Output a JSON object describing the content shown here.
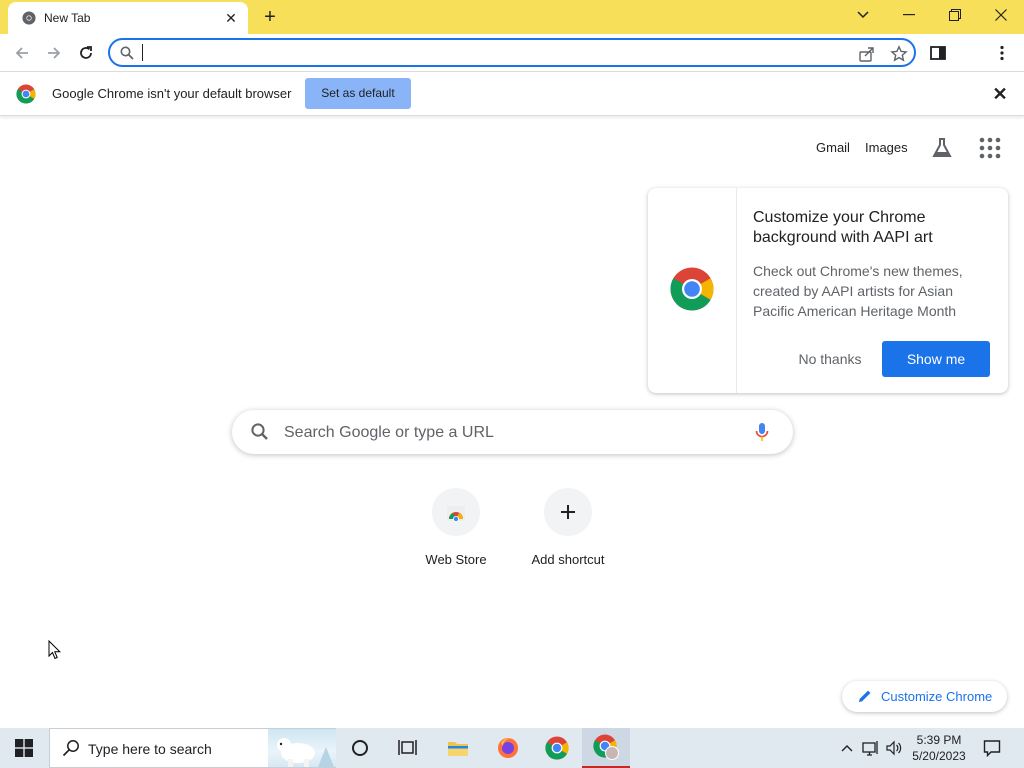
{
  "browser": {
    "tab_title": "New Tab",
    "omnibox_value": ""
  },
  "infobar": {
    "message": "Google Chrome isn't your default browser",
    "set_default_label": "Set as default"
  },
  "ntp": {
    "gmail_label": "Gmail",
    "images_label": "Images",
    "search_placeholder": "Search Google or type a URL",
    "shortcuts": [
      {
        "label": "Web Store"
      },
      {
        "label": "Add shortcut"
      }
    ],
    "customize_label": "Customize Chrome"
  },
  "promo": {
    "title": "Customize your Chrome background with AAPI art",
    "body": "Check out Chrome's new themes, created by AAPI artists for Asian Pacific American Heritage Month",
    "no_thanks_label": "No thanks",
    "show_me_label": "Show me"
  },
  "taskbar": {
    "search_placeholder": "Type here to search",
    "time": "5:39 PM",
    "date": "5/20/2023"
  },
  "colors": {
    "titlebar": "#f7df5a",
    "accent": "#1a73e8",
    "set_default_bg": "#8ab4f8"
  }
}
